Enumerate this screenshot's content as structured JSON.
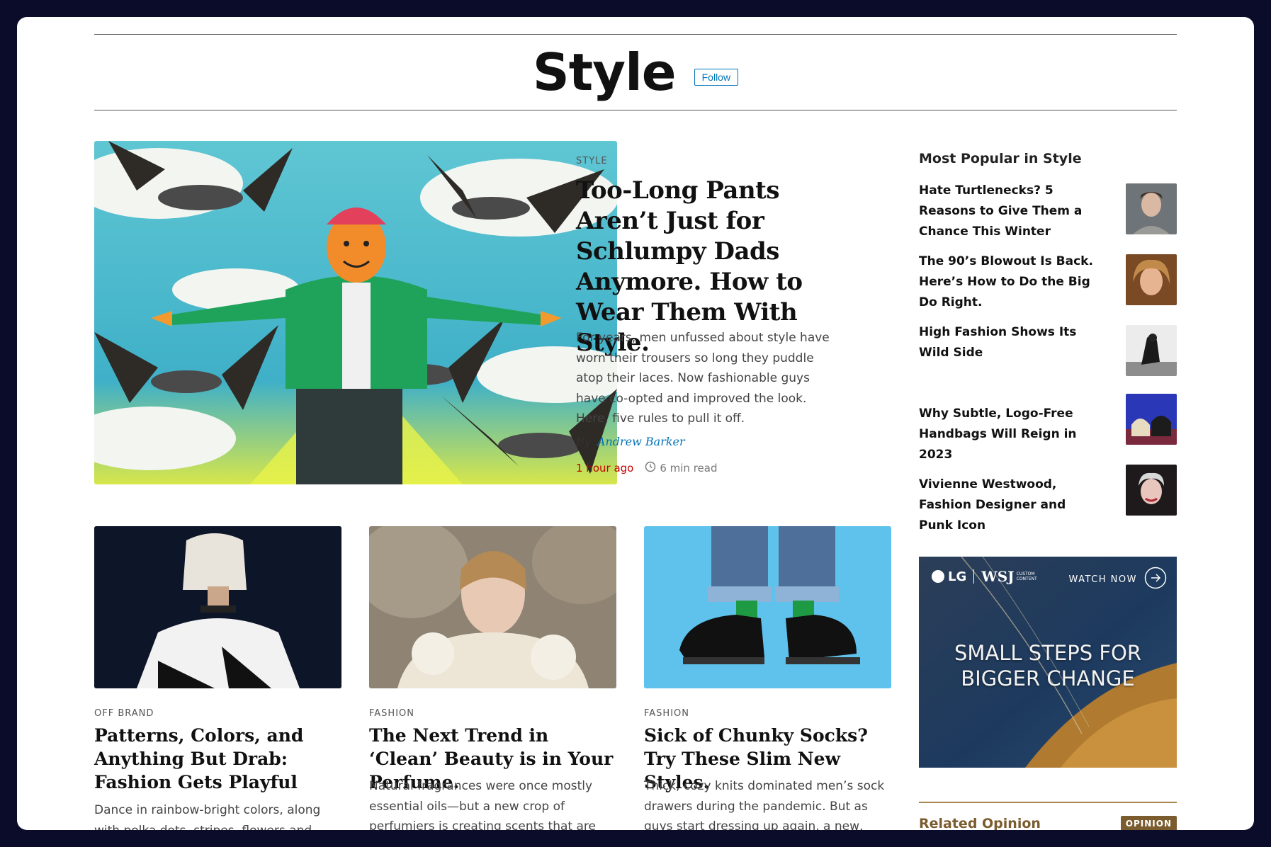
{
  "section": {
    "title": "Style",
    "follow_label": "Follow"
  },
  "lead": {
    "kicker": "STYLE",
    "headline": "Too-Long Pants Aren’t Just for Schlumpy Dads Anymore. How to Wear Them With Style.",
    "summary": "For years, men unfussed about style have worn their trousers so long they puddle atop their laces. Now fashionable guys have co-opted and improved the look. Here, five rules to pull it off.",
    "byline_prefix": "By",
    "author": "Andrew Barker",
    "time": "1 hour ago",
    "read_time": "6 min read"
  },
  "cards": [
    {
      "kicker": "OFF BRAND",
      "headline": "Patterns, Colors, and Anything But Drab: Fashion Gets Playful",
      "summary": "Dance in rainbow-bright colors, along with polka dots, stripes, flowers and"
    },
    {
      "kicker": "FASHION",
      "headline": "The Next Trend in ‘Clean’ Beauty is in Your Perfume.",
      "summary": "Natural fragrances were once mostly essential oils—but a new crop of perfumiers is creating scents that are both free of additives and complex"
    },
    {
      "kicker": "FASHION",
      "headline": "Sick of Chunky Socks? Try These Slim New Styles.",
      "summary": "Thick, cozy knits dominated men’s sock drawers during the pandemic. But as guys start dressing up again, a new, fine-yet-textured breed of sock is catching on"
    }
  ],
  "popular": {
    "heading": "Most Popular in Style",
    "items": [
      {
        "title": "Hate Turtlenecks? 5 Reasons to Give Them a Chance This Winter"
      },
      {
        "title": "The 90’s Blowout Is Back. Here’s How to Do the Big Do Right."
      },
      {
        "title": "High Fashion Shows Its Wild Side"
      },
      {
        "title": "Why Subtle, Logo-Free Handbags Will Reign in 2023"
      },
      {
        "title": "Vivienne Westwood, Fashion Designer and Punk Icon"
      }
    ]
  },
  "ad": {
    "brand": "LG",
    "partner": "WSJ",
    "partner_sub": "CUSTOM CONTENT",
    "cta": "WATCH NOW",
    "headline_line1": "SMALL STEPS FOR",
    "headline_line2": "BIGGER CHANGE"
  },
  "related": {
    "heading": "Related Opinion",
    "badge": "OPINION"
  },
  "colors": {
    "link_blue": "#0274b6",
    "timestamp_red": "#c80000",
    "opinion_brown": "#7a5c2e",
    "frame_bg": "#0b0c2a"
  },
  "icons": {
    "clock": "clock-icon",
    "arrow": "arrow-right-icon"
  }
}
